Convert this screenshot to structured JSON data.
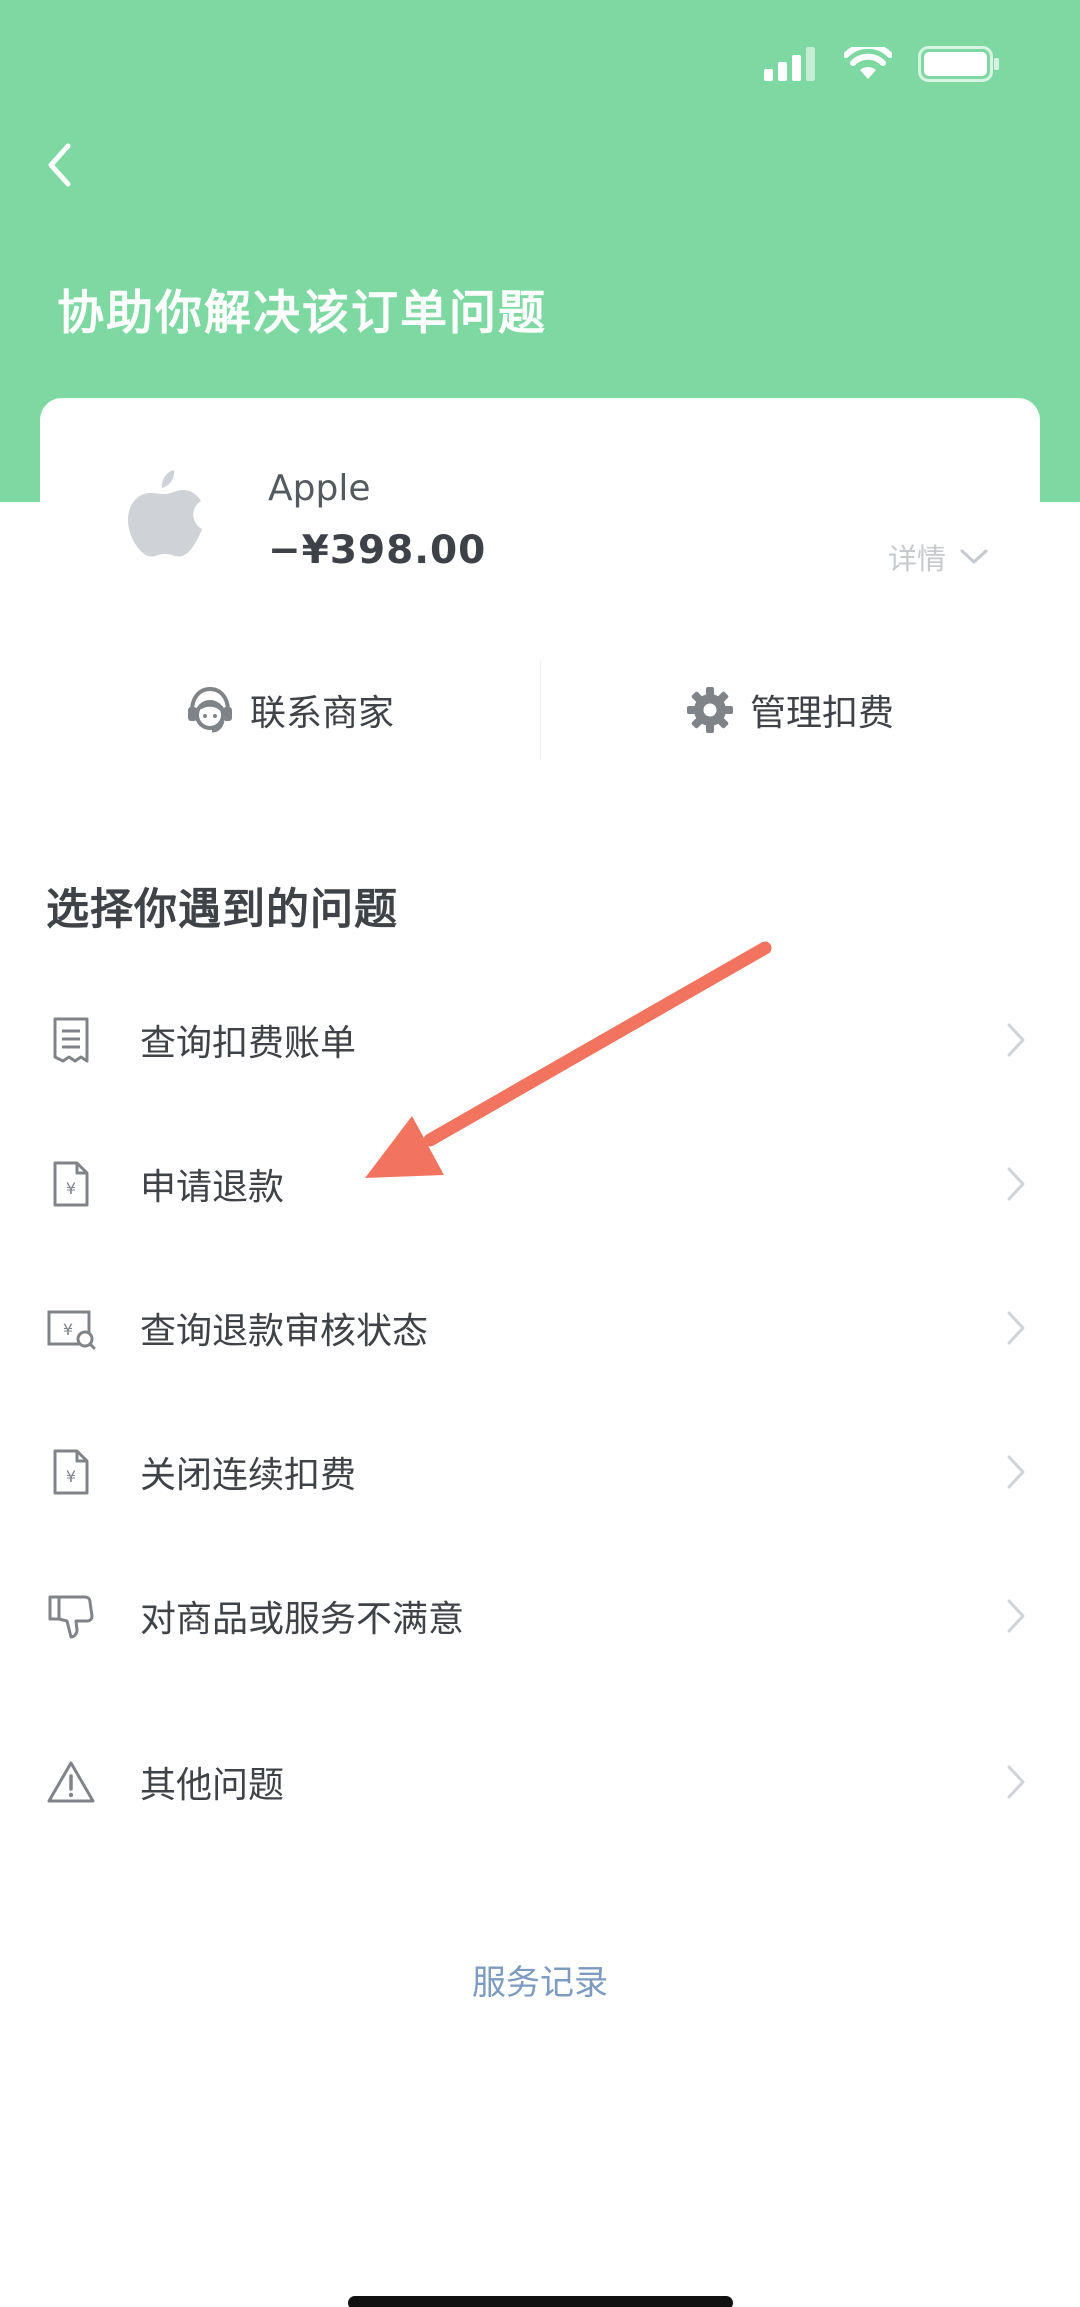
{
  "header": {
    "title": "协助你解决该订单问题"
  },
  "order": {
    "merchant": "Apple",
    "amount": "−¥398.00",
    "details_label": "详情"
  },
  "actions": {
    "contact_merchant": "联系商家",
    "manage_billing": "管理扣费"
  },
  "problems": {
    "section_title": "选择你遇到的问题",
    "items": [
      {
        "label": "查询扣费账单",
        "icon": "receipt-icon"
      },
      {
        "label": "申请退款",
        "icon": "yuan-document-icon"
      },
      {
        "label": "查询退款审核状态",
        "icon": "refund-status-icon"
      },
      {
        "label": "关闭连续扣费",
        "icon": "yuan-document-icon"
      },
      {
        "label": "对商品或服务不满意",
        "icon": "thumbs-down-icon"
      },
      {
        "label": "其他问题",
        "icon": "warning-icon"
      }
    ]
  },
  "footer": {
    "service_record": "服务记录"
  },
  "colors": {
    "header_green": "#7ED8A1",
    "annotation_arrow": "#F2735E",
    "link_blue": "#7C9BBF"
  }
}
